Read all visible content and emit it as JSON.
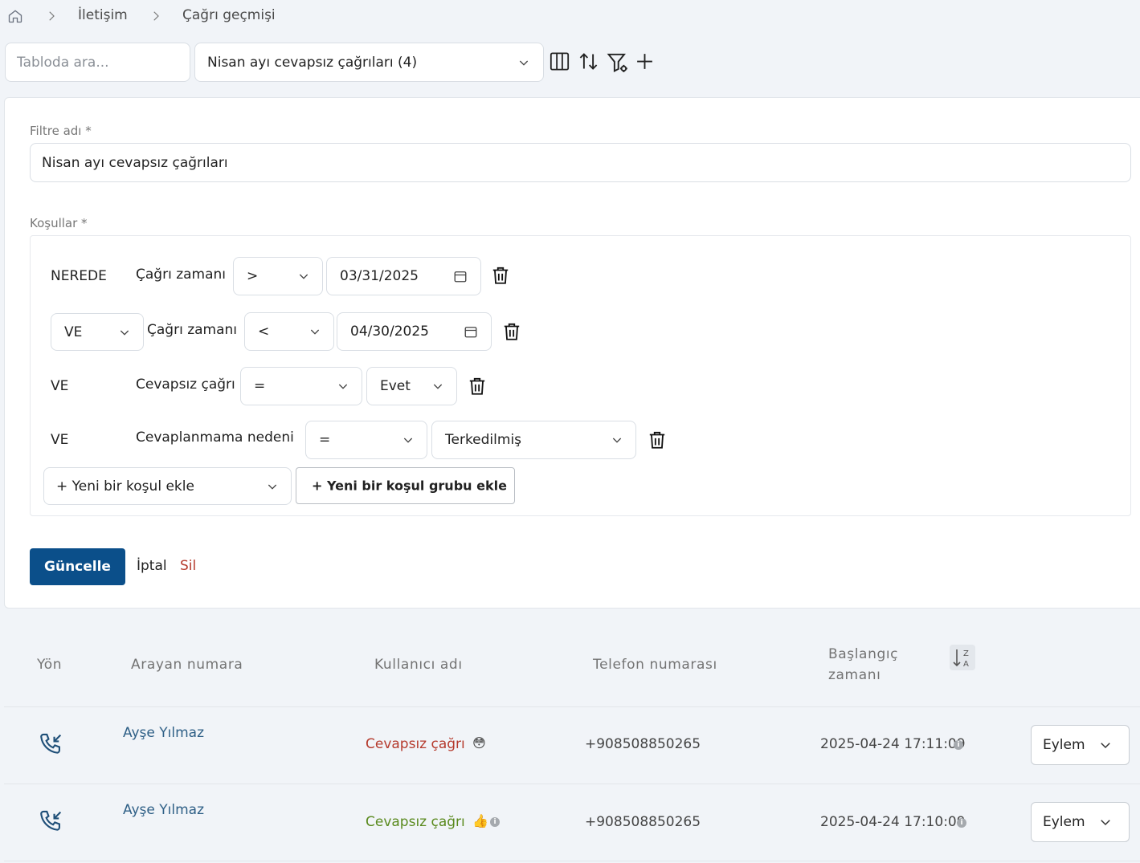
{
  "breadcrumb": {
    "items": [
      "İletişim",
      "Çağrı geçmişi"
    ]
  },
  "toolbar": {
    "search_placeholder": "Tabloda ara...",
    "view_select": "Nisan ayı cevapsız çağrıları (4)"
  },
  "filter": {
    "name_label": "Filtre adı *",
    "name_value": "Nisan ayı cevapsız çağrıları",
    "conditions_label": "Koşullar *",
    "conditions": [
      {
        "connector": "NEREDE",
        "field": "Çağrı zamanı",
        "operator": ">",
        "value": "03/31/2025"
      },
      {
        "connector": "VE",
        "field": "Çağrı zamanı",
        "operator": "<",
        "value": "04/30/2025"
      },
      {
        "connector": "VE",
        "field": "Cevapsız çağrı",
        "operator": "=",
        "value": "Evet"
      },
      {
        "connector": "VE",
        "field": "Cevaplanmama nedeni",
        "operator": "=",
        "value": "Terkedilmiş"
      }
    ],
    "add_condition": "+ Yeni bir koşul ekle",
    "add_group": "+ Yeni bir koşul grubu ekle",
    "update_button": "Güncelle",
    "cancel_button": "İptal",
    "delete_button": "Sil"
  },
  "table": {
    "headers": [
      "Yön",
      "Arayan numara",
      "Kullanıcı adı",
      "Telefon numarası",
      "Başlangıç",
      "zamanı"
    ],
    "rows": [
      {
        "caller": "Ayşe Yılmaz",
        "status": "Cevapsız çağrı",
        "status_emoji": "😳",
        "phone": "+908508850265",
        "start": "2025-04-24 17:11:09",
        "action": "Eylem"
      },
      {
        "caller": "Ayşe Yılmaz",
        "status": "Cevapsız çağrı",
        "status_emoji": "👍",
        "phone": "+908508850265",
        "start": "2025-04-24 17:10:09",
        "action": "Eylem"
      }
    ]
  },
  "colors": {
    "primary": "#0b4f8a",
    "missed_red": "#b53a2d",
    "missed_green": "#5a8a1e",
    "link": "#2e5f86",
    "delete_red": "#b53a2d"
  }
}
